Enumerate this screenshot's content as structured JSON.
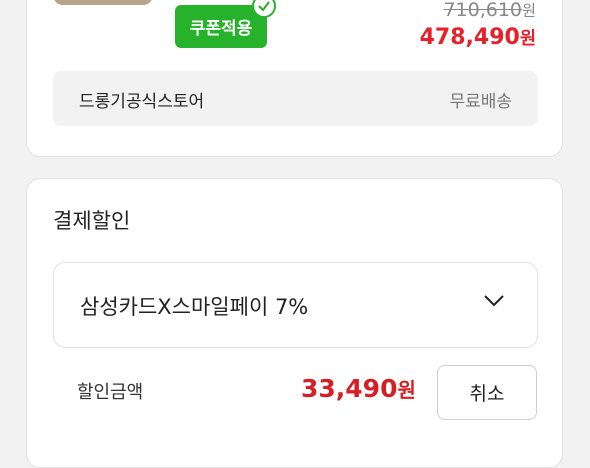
{
  "product": {
    "coupon_button": "쿠폰적용",
    "original_price": "710,610",
    "sale_price": "478,490",
    "currency_unit": "원"
  },
  "store": {
    "name": "드롱기공식스토어",
    "shipping": "무료배송"
  },
  "payment_discount": {
    "title": "결제할인",
    "selected_card": "삼성카드X스마일페이 7%",
    "discount_label": "할인금액",
    "discount_amount": "33,490",
    "currency_unit": "원",
    "cancel_button": "취소"
  },
  "colors": {
    "accent_red": "#e8202a",
    "coupon_green": "#27b22b"
  }
}
